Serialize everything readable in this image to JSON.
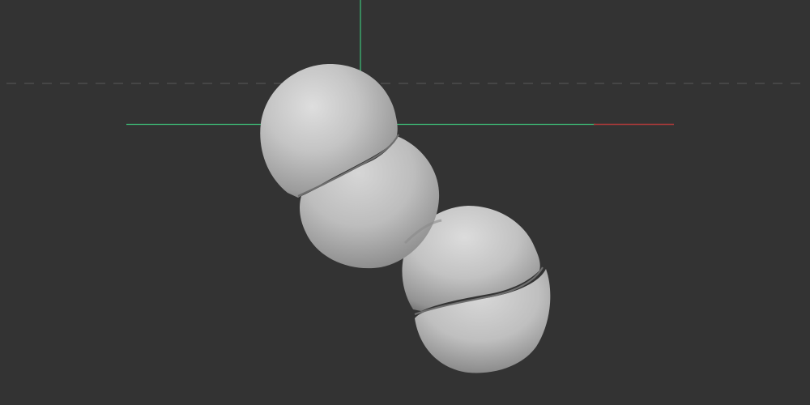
{
  "viewport": {
    "background_color": "#333333",
    "object": "segmented-sphere-mesh",
    "segment_count": 4,
    "mesh_color": "#c8c8c8"
  },
  "axes": {
    "x_axis_positive_color": "#b23a3a",
    "axis_green_color": "#3ec37a",
    "grid_line_color": "#555555",
    "grid_line_style": "dashed"
  }
}
